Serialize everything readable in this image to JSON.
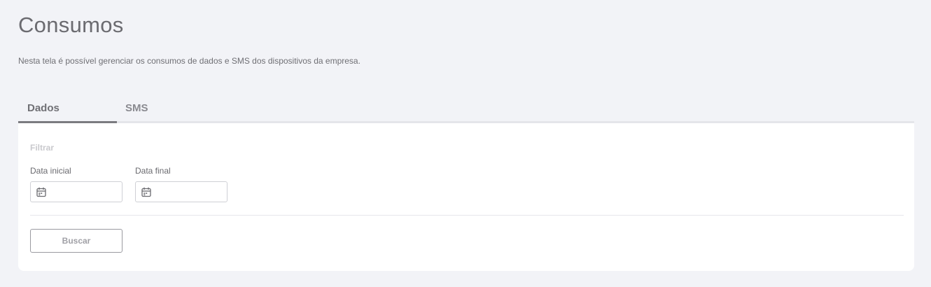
{
  "header": {
    "title": "Consumos",
    "subtitle": "Nesta tela é possível gerenciar os consumos de dados e SMS dos dispositivos da empresa."
  },
  "tabs": [
    {
      "label": "Dados",
      "active": true
    },
    {
      "label": "SMS",
      "active": false
    }
  ],
  "filter": {
    "section_label": "Filtrar",
    "start_date": {
      "label": "Data inicial",
      "value": "",
      "icon": "calendar-icon"
    },
    "end_date": {
      "label": "Data final",
      "value": "",
      "icon": "calendar-icon"
    },
    "search_button": "Buscar"
  }
}
